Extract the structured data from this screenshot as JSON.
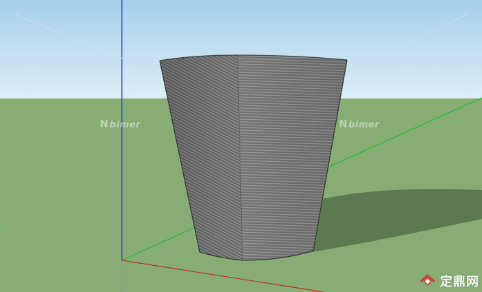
{
  "scene": {
    "description_hidden": "",
    "sky_top_color": "#a8d2ee",
    "sky_bottom_color": "#d7ecf7",
    "ground_color": "#86ae74",
    "shadow_color": "#5e7c51",
    "pot_color": "#6f6f6f",
    "axis_blue": "#2b3fd6",
    "axis_green": "#1fbf2a",
    "axis_red": "#c0301f"
  },
  "watermarks": {
    "left": "bimer",
    "right": "bimer"
  },
  "corner_logo": {
    "text": "定鼎网",
    "icon": "house-logo-icon"
  }
}
